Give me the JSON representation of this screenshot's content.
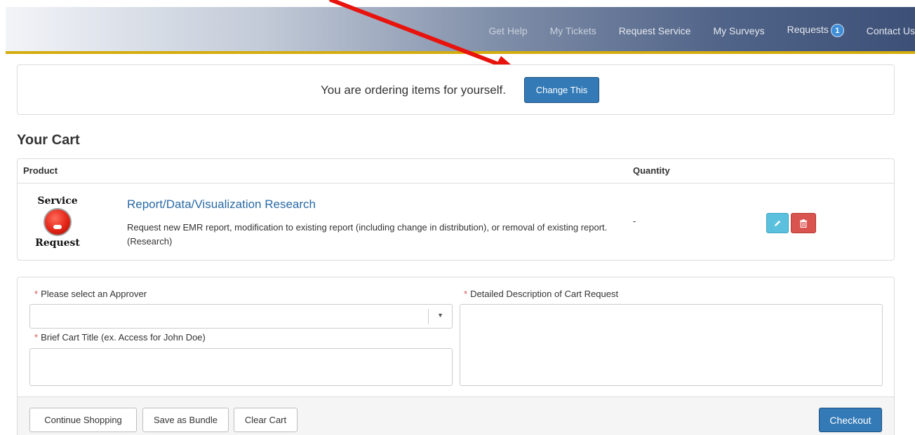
{
  "nav": {
    "items": [
      "Get Help",
      "My Tickets",
      "Request Service",
      "My Surveys",
      "Requests",
      "Contact Us"
    ],
    "requests_badge": "1"
  },
  "order_panel": {
    "text": "You are ordering items for yourself.",
    "change_button": "Change This"
  },
  "cart": {
    "title": "Your Cart",
    "columns": {
      "product": "Product",
      "quantity": "Quantity"
    },
    "item": {
      "logo_top": "Service",
      "logo_bottom": "Request",
      "name": "Report/Data/Visualization Research",
      "description": "Request new EMR report, modification to existing report (including change in distribution), or removal of existing report. (Research)",
      "quantity": "-"
    }
  },
  "form": {
    "required_mark": "*",
    "approver_label": "Please select an Approver",
    "approver_value": "",
    "title_label": "Brief Cart Title (ex. Access for John Doe)",
    "title_value": "",
    "description_label": "Detailed Description of Cart Request",
    "description_value": ""
  },
  "footer": {
    "continue_label": "Continue Shopping",
    "bundle_label": "Save as Bundle",
    "clear_label": "Clear Cart",
    "checkout_label": "Checkout"
  },
  "colors": {
    "primary": "#337ab7",
    "nav_accent": "#d4ac0d",
    "required": "#d9534f",
    "edit": "#5bc0de",
    "delete": "#d9534f",
    "annotation_arrow": "#e8130d"
  },
  "icons": [
    "pencil-icon",
    "trash-icon",
    "caret-down-icon",
    "service-request-logo"
  ]
}
